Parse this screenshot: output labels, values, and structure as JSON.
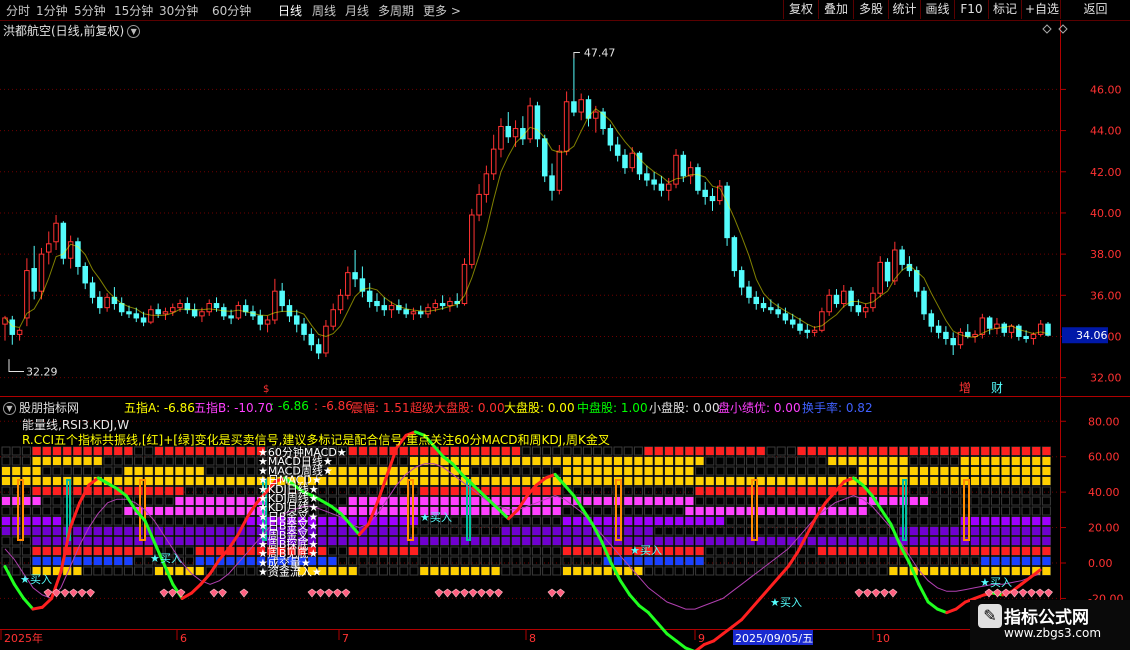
{
  "toolbar": {
    "periods": [
      {
        "label": "分时"
      },
      {
        "label": "1分钟"
      },
      {
        "label": "5分钟"
      },
      {
        "label": "15分钟"
      },
      {
        "label": "30分钟"
      },
      {
        "label": "60分钟"
      },
      {
        "label": "日线",
        "active": true
      },
      {
        "label": "周线"
      },
      {
        "label": "月线"
      },
      {
        "label": "多周期"
      },
      {
        "label": "更多 >"
      }
    ],
    "buttons": [
      {
        "label": "复权"
      },
      {
        "label": "叠加"
      },
      {
        "label": "多股"
      },
      {
        "label": "统计"
      },
      {
        "label": "画线"
      },
      {
        "label": "F10"
      },
      {
        "label": "标记"
      },
      {
        "label": "+自选"
      },
      {
        "label": "返回"
      }
    ]
  },
  "colors": {
    "up": "#ff3232",
    "down": "#54fcfc",
    "axis": "#b00000",
    "grid": "#6e0000",
    "ma": "#ffff00"
  },
  "price_panel": {
    "title": "洪都航空(日线,前复权)",
    "current_price": "34.06",
    "high_label": "47.47",
    "low_label": "32.29",
    "tag_zeng": "增",
    "tag_cai": "财"
  },
  "indicator_panel": {
    "title": "股朋指标网",
    "stats": [
      {
        "label": "五指A: -6.86",
        "color": "#ffff00"
      },
      {
        "label": "五指B: -10.70",
        "color": "#ff40ff"
      },
      {
        "label": ": -6.86",
        "color": "#00ff00"
      },
      {
        "label": ": -6.86",
        "color": "#ff3030"
      },
      {
        "label": "震幅: 1.51",
        "color": "#ff3030"
      },
      {
        "label": "超级大盘股: 0.00",
        "color": "#ff3030"
      },
      {
        "label": "大盘股: 0.00",
        "color": "#ffff00"
      },
      {
        "label": "中盘股: 1.00",
        "color": "#00ff00"
      },
      {
        "label": "小盘股: 0.00",
        "color": "#e0e0e0"
      },
      {
        "label": "盘小绩优: 0.00",
        "color": "#ff40ff"
      },
      {
        "label": "换手率: 0.82",
        "color": "#4060ff"
      }
    ],
    "line2": "能量线,RSI3.KDJ,W",
    "line3": "R.CCI五个指标共振线,[红]+[绿]变化是买卖信号,建议多标记是配合信号,重点关注60分MACD和周KDJ,周K金叉",
    "star_labels": [
      "★60分钟MACD★",
      "★MACD日线★",
      "★MACD周线★",
      "★日MACD★",
      "★KDJ日线★",
      "★KDJ周线★",
      "★KDJ月线★",
      "★日B金叉★",
      "★日B金叉★",
      "★周B金叉★",
      "★周B探底★",
      "★周B见底★",
      "★成交量★",
      "★资金流入★"
    ],
    "signal_buy": "买入",
    "signal_sell": "卖出"
  },
  "chart_data": [
    {
      "type": "candlestick",
      "title": "洪都航空(日线,前复权)",
      "y_ticks": [
        32,
        34,
        36,
        38,
        40,
        42,
        44,
        46
      ],
      "ylim": [
        31.4,
        48.4
      ],
      "high": 47.47,
      "low": 32.29,
      "last": 34.06,
      "ohlc_note": "approximate daily candles read from picture",
      "candles": [
        [
          34.6,
          35.0,
          33.8,
          34.9
        ],
        [
          34.8,
          35.0,
          33.6,
          34.1
        ],
        [
          34.1,
          34.4,
          33.8,
          34.3
        ],
        [
          34.9,
          37.8,
          34.5,
          37.2
        ],
        [
          37.3,
          38.4,
          35.8,
          36.2
        ],
        [
          36.2,
          38.3,
          35.8,
          38.0
        ],
        [
          38.1,
          39.1,
          37.5,
          38.5
        ],
        [
          38.6,
          39.9,
          38.2,
          39.5
        ],
        [
          39.5,
          39.6,
          37.5,
          37.8
        ],
        [
          37.8,
          38.9,
          37.3,
          38.6
        ],
        [
          38.6,
          38.8,
          37.0,
          37.4
        ],
        [
          37.4,
          37.6,
          36.3,
          36.6
        ],
        [
          36.6,
          36.9,
          35.6,
          35.9
        ],
        [
          35.9,
          36.2,
          35.1,
          35.4
        ],
        [
          35.4,
          36.1,
          35.2,
          35.9
        ],
        [
          35.9,
          36.4,
          35.3,
          35.6
        ],
        [
          35.6,
          35.9,
          35.0,
          35.2
        ],
        [
          35.2,
          35.5,
          34.9,
          35.1
        ],
        [
          35.1,
          35.4,
          34.7,
          34.9
        ],
        [
          34.9,
          35.2,
          34.5,
          34.7
        ],
        [
          34.7,
          35.5,
          34.6,
          35.3
        ],
        [
          35.3,
          35.6,
          34.9,
          35.1
        ],
        [
          35.1,
          35.4,
          34.8,
          35.2
        ],
        [
          35.2,
          35.6,
          35.0,
          35.4
        ],
        [
          35.4,
          35.8,
          35.2,
          35.6
        ],
        [
          35.6,
          35.9,
          35.1,
          35.3
        ],
        [
          35.3,
          35.6,
          34.9,
          35.0
        ],
        [
          35.0,
          35.4,
          34.7,
          35.2
        ],
        [
          35.2,
          35.8,
          35.0,
          35.6
        ],
        [
          35.6,
          35.9,
          35.2,
          35.4
        ],
        [
          35.4,
          35.6,
          34.8,
          35.0
        ],
        [
          35.0,
          35.3,
          34.6,
          34.9
        ],
        [
          34.9,
          35.7,
          34.8,
          35.5
        ],
        [
          35.5,
          35.8,
          35.0,
          35.2
        ],
        [
          35.2,
          35.5,
          34.8,
          35.0
        ],
        [
          35.0,
          35.3,
          34.3,
          34.6
        ],
        [
          34.6,
          35.0,
          34.2,
          34.8
        ],
        [
          34.8,
          36.8,
          34.6,
          36.2
        ],
        [
          36.2,
          36.6,
          35.2,
          35.5
        ],
        [
          35.5,
          35.8,
          34.7,
          35.0
        ],
        [
          35.0,
          35.3,
          34.2,
          34.6
        ],
        [
          34.6,
          34.9,
          33.8,
          34.1
        ],
        [
          34.1,
          34.4,
          33.3,
          33.6
        ],
        [
          33.6,
          33.9,
          32.9,
          33.2
        ],
        [
          33.2,
          34.8,
          33.0,
          34.5
        ],
        [
          34.5,
          35.6,
          34.3,
          35.3
        ],
        [
          35.3,
          36.3,
          35.1,
          36.0
        ],
        [
          36.0,
          37.4,
          35.8,
          37.1
        ],
        [
          37.1,
          38.2,
          36.4,
          36.8
        ],
        [
          36.8,
          37.4,
          35.9,
          36.2
        ],
        [
          36.2,
          36.6,
          35.4,
          35.7
        ],
        [
          35.7,
          36.1,
          35.2,
          35.5
        ],
        [
          35.5,
          35.9,
          35.0,
          35.3
        ],
        [
          35.3,
          35.7,
          34.9,
          35.5
        ],
        [
          35.5,
          35.8,
          35.1,
          35.3
        ],
        [
          35.3,
          35.6,
          34.9,
          35.1
        ],
        [
          35.1,
          35.4,
          34.8,
          35.2
        ],
        [
          35.2,
          35.5,
          34.9,
          35.1
        ],
        [
          35.1,
          35.6,
          34.9,
          35.4
        ],
        [
          35.4,
          35.8,
          35.2,
          35.6
        ],
        [
          35.6,
          36.0,
          35.3,
          35.5
        ],
        [
          35.5,
          35.9,
          35.2,
          35.7
        ],
        [
          35.7,
          36.1,
          35.4,
          35.6
        ],
        [
          35.6,
          37.8,
          35.5,
          37.5
        ],
        [
          37.5,
          40.2,
          37.3,
          39.9
        ],
        [
          39.9,
          41.4,
          39.6,
          40.9
        ],
        [
          40.9,
          42.3,
          40.5,
          41.9
        ],
        [
          41.9,
          43.8,
          41.6,
          43.1
        ],
        [
          43.1,
          44.6,
          42.7,
          44.2
        ],
        [
          44.2,
          44.9,
          43.4,
          43.7
        ],
        [
          43.7,
          44.5,
          43.2,
          44.1
        ],
        [
          44.1,
          44.7,
          43.3,
          43.6
        ],
        [
          43.6,
          45.6,
          43.4,
          45.2
        ],
        [
          45.2,
          45.4,
          43.2,
          43.6
        ],
        [
          43.6,
          43.8,
          41.5,
          41.8
        ],
        [
          41.8,
          42.4,
          40.6,
          41.1
        ],
        [
          41.1,
          43.3,
          40.9,
          43.0
        ],
        [
          43.0,
          45.9,
          42.8,
          45.4
        ],
        [
          45.4,
          47.5,
          44.7,
          44.9
        ],
        [
          44.9,
          45.8,
          44.5,
          45.5
        ],
        [
          45.5,
          45.7,
          44.2,
          44.6
        ],
        [
          44.6,
          45.2,
          43.9,
          44.9
        ],
        [
          44.9,
          45.1,
          43.8,
          44.1
        ],
        [
          44.1,
          44.3,
          43.0,
          43.3
        ],
        [
          43.3,
          43.7,
          42.5,
          42.8
        ],
        [
          42.8,
          43.1,
          41.9,
          42.2
        ],
        [
          42.2,
          43.2,
          42.0,
          42.9
        ],
        [
          42.9,
          43.0,
          41.6,
          41.9
        ],
        [
          41.9,
          42.3,
          41.3,
          41.6
        ],
        [
          41.6,
          42.0,
          41.1,
          41.4
        ],
        [
          41.4,
          41.8,
          40.8,
          41.1
        ],
        [
          41.1,
          41.7,
          40.6,
          41.4
        ],
        [
          41.4,
          43.1,
          41.2,
          42.8
        ],
        [
          42.8,
          43.0,
          41.5,
          41.8
        ],
        [
          41.8,
          42.5,
          41.4,
          42.2
        ],
        [
          42.2,
          42.4,
          40.9,
          41.1
        ],
        [
          41.1,
          41.5,
          40.4,
          40.8
        ],
        [
          40.8,
          41.2,
          40.1,
          40.6
        ],
        [
          40.6,
          41.6,
          40.4,
          41.3
        ],
        [
          41.3,
          41.5,
          38.4,
          38.8
        ],
        [
          38.8,
          38.9,
          36.9,
          37.2
        ],
        [
          37.2,
          37.4,
          36.0,
          36.4
        ],
        [
          36.4,
          36.7,
          35.6,
          35.9
        ],
        [
          35.9,
          36.2,
          35.3,
          35.6
        ],
        [
          35.6,
          35.9,
          35.2,
          35.4
        ],
        [
          35.4,
          35.8,
          35.1,
          35.3
        ],
        [
          35.3,
          35.6,
          34.9,
          35.1
        ],
        [
          35.1,
          35.4,
          34.6,
          34.8
        ],
        [
          34.8,
          35.1,
          34.4,
          34.6
        ],
        [
          34.6,
          34.9,
          34.1,
          34.3
        ],
        [
          34.3,
          34.6,
          33.9,
          34.2
        ],
        [
          34.2,
          34.5,
          34.0,
          34.3
        ],
        [
          34.3,
          35.4,
          34.2,
          35.2
        ],
        [
          35.2,
          36.3,
          35.0,
          36.0
        ],
        [
          36.0,
          36.3,
          35.4,
          35.6
        ],
        [
          35.6,
          36.5,
          35.4,
          36.2
        ],
        [
          36.2,
          36.4,
          35.2,
          35.5
        ],
        [
          35.5,
          35.8,
          35.0,
          35.2
        ],
        [
          35.2,
          35.6,
          34.9,
          35.4
        ],
        [
          35.4,
          36.4,
          35.2,
          36.1
        ],
        [
          36.1,
          37.9,
          35.9,
          37.6
        ],
        [
          37.6,
          37.8,
          36.4,
          36.7
        ],
        [
          36.7,
          38.6,
          36.5,
          38.2
        ],
        [
          38.2,
          38.4,
          37.2,
          37.5
        ],
        [
          37.5,
          37.9,
          36.9,
          37.2
        ],
        [
          37.2,
          37.4,
          35.9,
          36.2
        ],
        [
          36.2,
          36.4,
          34.8,
          35.1
        ],
        [
          35.1,
          35.3,
          34.2,
          34.5
        ],
        [
          34.5,
          34.8,
          33.9,
          34.2
        ],
        [
          34.2,
          34.5,
          33.6,
          33.9
        ],
        [
          33.9,
          34.2,
          33.1,
          33.6
        ],
        [
          33.6,
          34.4,
          33.4,
          34.2
        ],
        [
          34.2,
          34.6,
          33.9,
          34.0
        ],
        [
          34.0,
          34.3,
          33.7,
          34.1
        ],
        [
          34.1,
          35.1,
          33.9,
          34.9
        ],
        [
          34.9,
          35.0,
          34.1,
          34.4
        ],
        [
          34.4,
          34.9,
          34.1,
          34.6
        ],
        [
          34.6,
          34.7,
          34.0,
          34.2
        ],
        [
          34.2,
          34.6,
          33.9,
          34.5
        ],
        [
          34.5,
          34.6,
          33.8,
          34.0
        ],
        [
          34.0,
          34.3,
          33.7,
          33.9
        ],
        [
          33.9,
          34.2,
          33.6,
          34.1
        ],
        [
          34.1,
          34.8,
          34.0,
          34.6
        ],
        [
          34.6,
          34.7,
          34.0,
          34.06
        ]
      ]
    },
    {
      "type": "line",
      "title": "股朋指标网",
      "y_ticks": [
        -20,
        0,
        20,
        40,
        60,
        80
      ],
      "ylim": [
        -35,
        92
      ],
      "x_labels": [
        {
          "label": "2025年",
          "x": 4
        },
        {
          "label": "6",
          "x": 180
        },
        {
          "label": "7",
          "x": 342
        },
        {
          "label": "8",
          "x": 529
        },
        {
          "label": "9",
          "x": 698
        },
        {
          "label": "2025/09/05/五",
          "x": 735,
          "highlight": true
        },
        {
          "label": "10",
          "x": 876
        }
      ],
      "series": [
        {
          "name": "",
          "color": "#ff2020",
          "style": "resonance",
          "values": [
            -2,
            -12,
            -20,
            -26,
            -25,
            -20,
            -5,
            20,
            34,
            44,
            48,
            45,
            42,
            38,
            30,
            24,
            12,
            0,
            -12,
            -20,
            -17,
            -12,
            -6,
            2,
            8,
            16,
            26,
            34,
            40,
            46,
            48,
            44,
            40,
            38,
            35,
            32,
            28,
            22,
            16,
            22,
            35,
            50,
            65,
            72,
            74,
            72,
            66,
            60,
            56,
            50,
            45,
            40,
            35,
            30,
            25,
            30,
            38,
            44,
            48,
            50,
            44,
            38,
            30,
            22,
            12,
            0,
            -10,
            -18,
            -24,
            -28,
            -34,
            -40,
            -44,
            -48,
            -50,
            -46,
            -44,
            -40,
            -36,
            -32,
            -26,
            -20,
            -14,
            -8,
            -2,
            6,
            16,
            26,
            34,
            40,
            46,
            48,
            44,
            38,
            30,
            22,
            10,
            0,
            -12,
            -22,
            -26,
            -28,
            -26,
            -22,
            -20,
            -18,
            -17,
            -18,
            -16,
            -12,
            -8,
            -4
          ]
        },
        {
          "name": "",
          "color": "#b040b0",
          "style": "thin",
          "values": [
            8,
            2,
            -6,
            -14,
            -18,
            -20,
            -14,
            -2,
            10,
            20,
            28,
            34,
            36,
            36,
            34,
            30,
            24,
            16,
            8,
            0,
            -6,
            -10,
            -12,
            -10,
            -6,
            0,
            6,
            12,
            18,
            24,
            28,
            30,
            32,
            32,
            30,
            28,
            26,
            22,
            20,
            22,
            28,
            36,
            44,
            50,
            54,
            56,
            56,
            54,
            50,
            46,
            42,
            38,
            34,
            32,
            30,
            30,
            32,
            34,
            36,
            38,
            36,
            32,
            28,
            22,
            16,
            10,
            4,
            -2,
            -8,
            -14,
            -18,
            -22,
            -24,
            -26,
            -26,
            -24,
            -22,
            -20,
            -16,
            -12,
            -8,
            -4,
            0,
            4,
            8,
            14,
            20,
            26,
            30,
            34,
            36,
            38,
            36,
            32,
            26,
            20,
            12,
            4,
            -4,
            -10,
            -14,
            -16,
            -16,
            -15,
            -14,
            -13,
            -12,
            -12,
            -11,
            -10,
            -8,
            -6
          ]
        }
      ]
    }
  ]
}
